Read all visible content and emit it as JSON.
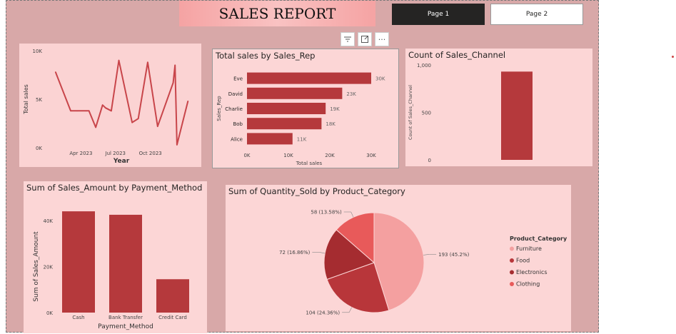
{
  "header": {
    "title": "SALES REPORT"
  },
  "nav": {
    "page1": "Page 1",
    "page2": "Page 2"
  },
  "toolbar": {
    "filter_icon": "filter-icon",
    "focus_icon": "focus-mode-icon",
    "more_label": "···"
  },
  "colors": {
    "bar": "#b5393c",
    "line": "#c8454a",
    "pie": [
      "#f4a0a0",
      "#b8363a",
      "#a52c30",
      "#e85a5a"
    ]
  },
  "chart_data": [
    {
      "type": "line",
      "title": "",
      "xlabel": "Year",
      "ylabel": "Total sales",
      "xticks": [
        "Apr 2023",
        "Jul 2023",
        "Oct 2023"
      ],
      "yticks": [
        "0K",
        "5K",
        "10K"
      ],
      "ylim": [
        0,
        10000
      ],
      "x": [
        "2023-01-24",
        "2023-01-28",
        "2023-02-20",
        "2023-03-05",
        "2023-03-22",
        "2023-04-14",
        "2023-04-22",
        "2023-05-10",
        "2023-05-28",
        "2023-06-05",
        "2023-06-20",
        "2023-07-10",
        "2023-08-14",
        "2023-08-30",
        "2023-09-24",
        "2023-10-20",
        "2023-11-30",
        "2023-12-05",
        "2023-12-10",
        "2024-01-08"
      ],
      "values": [
        7800,
        7400,
        5100,
        3800,
        3800,
        3800,
        3800,
        2100,
        4400,
        4100,
        3800,
        9000,
        2600,
        3000,
        8800,
        2200,
        6700,
        8500,
        300,
        4800
      ],
      "grid": false
    },
    {
      "type": "bar",
      "orientation": "horizontal",
      "title": "Total sales by Sales_Rep",
      "xlabel": "Total sales",
      "ylabel": "Sales_Rep",
      "categories": [
        "Eve",
        "David",
        "Charlie",
        "Bob",
        "Alice"
      ],
      "values": [
        30000,
        23000,
        19000,
        18000,
        11000
      ],
      "data_labels": [
        "30K",
        "23K",
        "19K",
        "18K",
        "11K"
      ],
      "xticks": [
        "0K",
        "10K",
        "20K",
        "30K"
      ],
      "xlim": [
        0,
        30000
      ]
    },
    {
      "type": "bar",
      "title": "Count of Sales_Channel",
      "xlabel": "",
      "ylabel": "Count of Sales_Channel",
      "categories": [
        ""
      ],
      "values": [
        930
      ],
      "yticks": [
        "0",
        "500",
        "1,000"
      ],
      "ylim": [
        0,
        1000
      ]
    },
    {
      "type": "bar",
      "title": "Sum of Sales_Amount by Payment_Method",
      "xlabel": "Payment_Method",
      "ylabel": "Sum of Sales_Amount",
      "categories": [
        "Cash",
        "Bank Transfer",
        "Credit Card"
      ],
      "values": [
        44000,
        42500,
        14500
      ],
      "yticks": [
        "0K",
        "20K",
        "40K"
      ],
      "ylim": [
        0,
        40000
      ]
    },
    {
      "type": "pie",
      "title": "Sum of Quantity_Sold by Product_Category",
      "legend_title": "Product_Category",
      "legend_position": "right",
      "categories": [
        "Furniture",
        "Food",
        "Electronics",
        "Clothing"
      ],
      "values": [
        193,
        104,
        72,
        58
      ],
      "data_labels": [
        "193 (45.2%)",
        "104 (24.36%)",
        "72 (16.86%)",
        "58 (13.58%)"
      ]
    }
  ]
}
